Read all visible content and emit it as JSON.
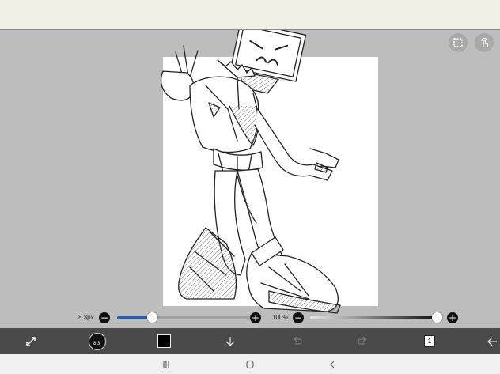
{
  "brush_panel": {
    "size_label": "8.3px",
    "size_fraction": 0.26,
    "opacity_label": "100%",
    "opacity_fraction": 1.0,
    "minus_symbol": "−",
    "plus_symbol": "+"
  },
  "toolbar": {
    "brush_size_badge": "8.3",
    "current_color": "#000000",
    "layer_number": "1"
  },
  "colors": {
    "topbar": "#f1f0e4",
    "canvas_bg": "#bdbdbd",
    "toolbar_bg": "#4a4a4a",
    "slider_accent": "#2a5db0"
  },
  "icons": [
    "select-icon",
    "touch-icon",
    "transform-icon",
    "brush-icon",
    "color-icon",
    "download-icon",
    "undo-icon",
    "redo-icon",
    "layers-icon",
    "back-arrow-icon",
    "nav-recent-icon",
    "nav-home-icon",
    "nav-back-icon"
  ]
}
